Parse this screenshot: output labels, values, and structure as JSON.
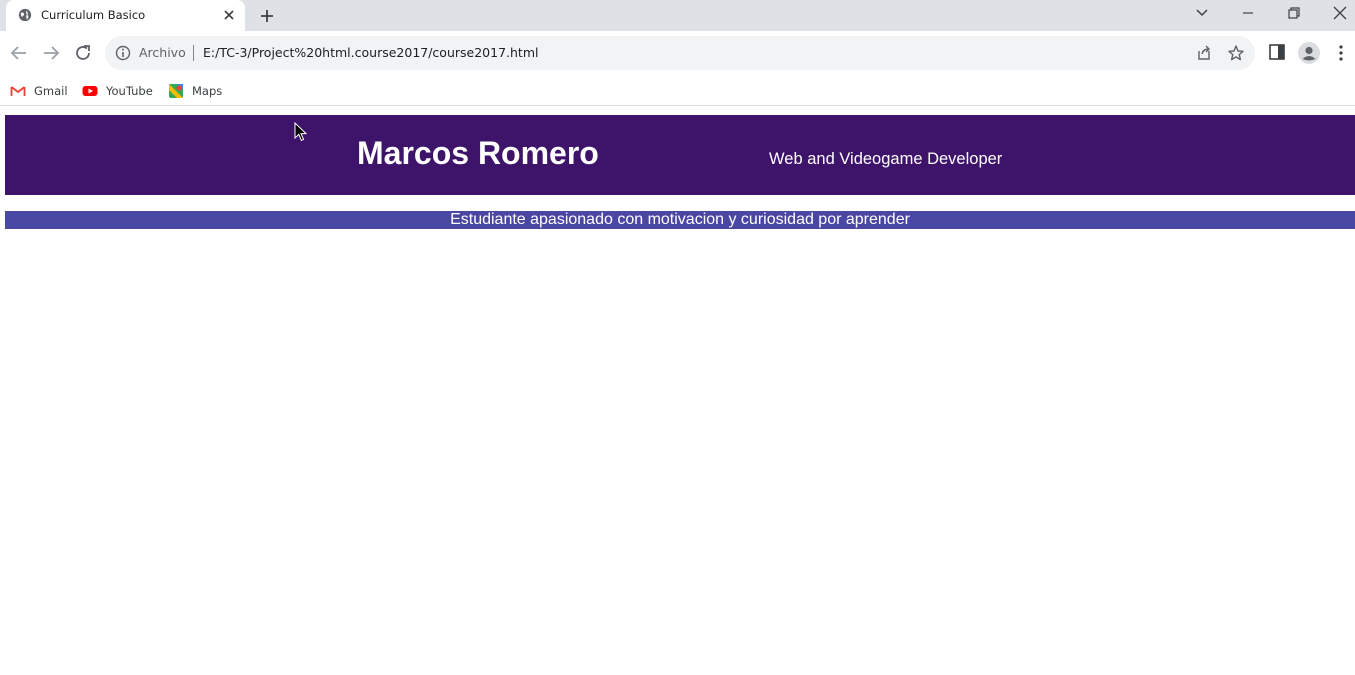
{
  "browser": {
    "tab": {
      "title": "Curriculum Basico"
    },
    "address_bar": {
      "scheme_label": "Archivo",
      "url": "E:/TC-3/Project%20html.course2017/course2017.html"
    },
    "bookmarks": [
      {
        "label": "Gmail",
        "icon": "gmail-icon"
      },
      {
        "label": "YouTube",
        "icon": "youtube-icon"
      },
      {
        "label": "Maps",
        "icon": "maps-icon"
      }
    ]
  },
  "page": {
    "header": {
      "name": "Marcos Romero",
      "role": "Web and Videogame Developer"
    },
    "tagline": "Estudiante apasionado con motivacion y curiosidad por aprender",
    "colors": {
      "header_bg": "#3d1469",
      "tagline_bg": "#4a47a3",
      "text": "#ffffff"
    }
  }
}
